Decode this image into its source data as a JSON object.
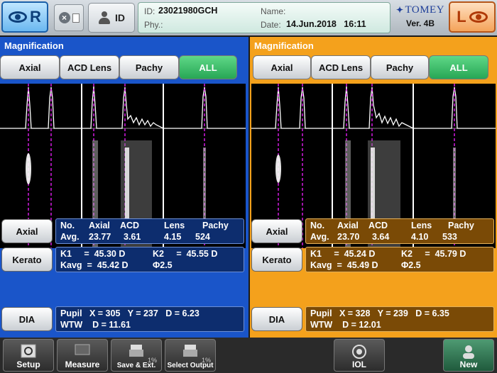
{
  "header": {
    "right_eye_label": "R",
    "left_eye_label": "L",
    "id_button_label": "ID",
    "id_label": "ID:",
    "id_value": "23021980GCH",
    "phy_label": "Phy.:",
    "phy_value": "",
    "name_label": "Name:",
    "name_value": "",
    "date_label": "Date:",
    "date_value": "14.Jun.2018   16:11",
    "brand": "TOMEY",
    "version": "Ver. 4B"
  },
  "right_panel": {
    "title": "Magnification",
    "tabs": [
      "Axial",
      "ACD Lens",
      "Pachy",
      "ALL"
    ],
    "active_tab": "ALL",
    "axial_button": "Axial",
    "axial_header": {
      "no": "No.",
      "axial": "Axial",
      "acd": "ACD",
      "lens": "Lens",
      "pachy": "Pachy"
    },
    "axial_avg": {
      "label": "Avg.",
      "axial": "23.77",
      "acd": "3.61",
      "lens": "4.15",
      "pachy": "524"
    },
    "kerato_button": "Kerato",
    "k1": "K1     =  45.30 D",
    "k2": "K2     =  45.55 D",
    "kavg": "Kavg  =  45.42 D",
    "phi": "Φ2.5",
    "dia_button": "DIA",
    "pupil": "Pupil   X = 305   Y = 237   D = 6.23",
    "wtw": "WTW    D = 11.61"
  },
  "left_panel": {
    "title": "Magnification",
    "tabs": [
      "Axial",
      "ACD Lens",
      "Pachy",
      "ALL"
    ],
    "active_tab": "ALL",
    "axial_button": "Axial",
    "axial_header": {
      "no": "No.",
      "axial": "Axial",
      "acd": "ACD",
      "lens": "Lens",
      "pachy": "Pachy"
    },
    "axial_avg": {
      "label": "Avg.",
      "axial": "23.70",
      "acd": "3.64",
      "lens": "4.10",
      "pachy": "533"
    },
    "kerato_button": "Kerato",
    "k1": "K1     =  45.24 D",
    "k2": "K2     =  45.79 D",
    "kavg": "Kavg  =  45.49 D",
    "phi": "Φ2.5",
    "dia_button": "DIA",
    "pupil": "Pupil   X = 328   Y = 239   D = 6.35",
    "wtw": "WTW    D = 12.01"
  },
  "bottom_bar": {
    "setup": "Setup",
    "measure": "Measure",
    "save_ext": "Save & Ext.",
    "save_pct": "1%",
    "select_output": "Select Output",
    "select_pct": "1%",
    "iol": "IOL",
    "new": "New"
  },
  "colors": {
    "right_panel_bg": "#1a55c9",
    "left_panel_bg": "#f4a11c",
    "active_tab": "#27a655",
    "scan_marker": "#d21adf"
  }
}
